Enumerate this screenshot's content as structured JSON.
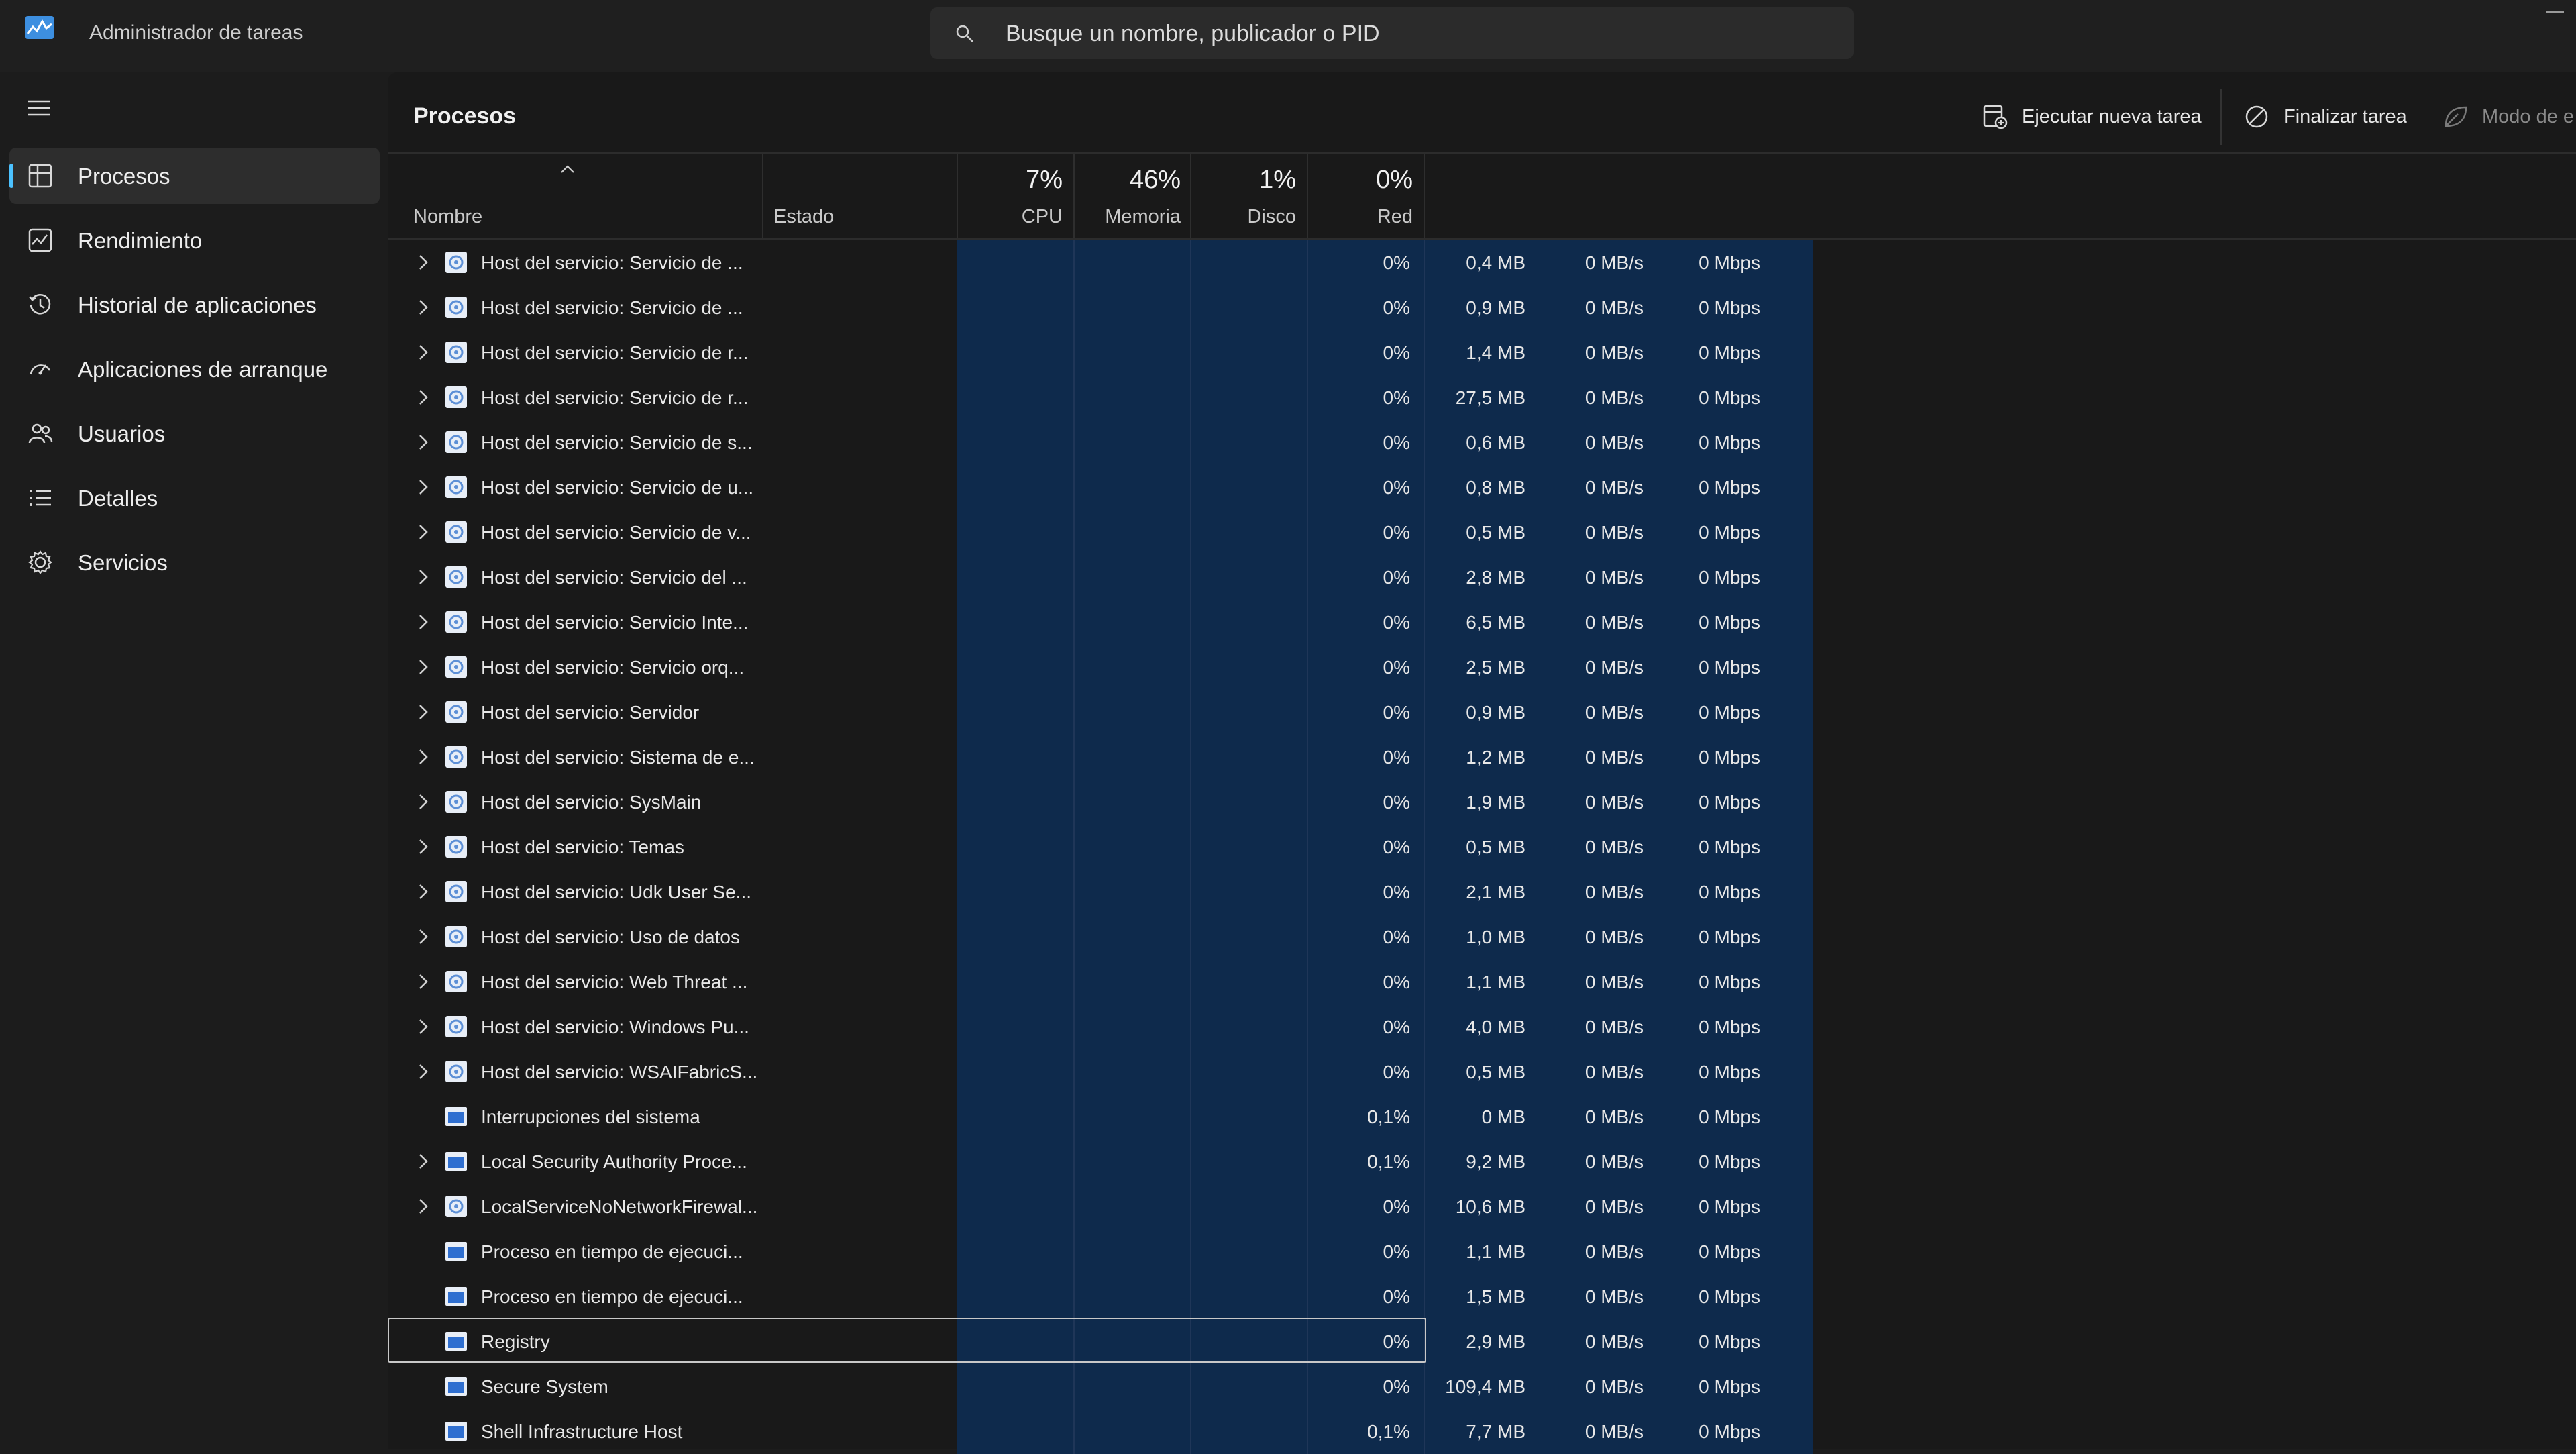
{
  "window": {
    "title": "Administrador de tareas"
  },
  "search": {
    "placeholder": "Busque un nombre, publicador o PID"
  },
  "sidebar": {
    "items": [
      {
        "label": "Procesos",
        "icon": "processes-icon",
        "active": true
      },
      {
        "label": "Rendimiento",
        "icon": "performance-icon"
      },
      {
        "label": "Historial de aplicaciones",
        "icon": "history-icon"
      },
      {
        "label": "Aplicaciones de arranque",
        "icon": "startup-icon"
      },
      {
        "label": "Usuarios",
        "icon": "users-icon"
      },
      {
        "label": "Detalles",
        "icon": "details-icon"
      },
      {
        "label": "Servicios",
        "icon": "services-icon"
      }
    ]
  },
  "toolbar": {
    "page_title": "Procesos",
    "run_task": "Ejecutar nueva tarea",
    "end_task": "Finalizar tarea",
    "efficiency": "Modo de e"
  },
  "table": {
    "headers": {
      "name": "Nombre",
      "status": "Estado",
      "cpu": {
        "pct": "7%",
        "label": "CPU"
      },
      "memory": {
        "pct": "46%",
        "label": "Memoria"
      },
      "disk": {
        "pct": "1%",
        "label": "Disco"
      },
      "network": {
        "pct": "0%",
        "label": "Red"
      }
    },
    "rows": [
      {
        "name": "Host del servicio: Servicio de ...",
        "cpu": "0%",
        "mem": "0,4 MB",
        "disk": "0 MB/s",
        "net": "0 Mbps",
        "expandable": true,
        "icon": "gear"
      },
      {
        "name": "Host del servicio: Servicio de ...",
        "cpu": "0%",
        "mem": "0,9 MB",
        "disk": "0 MB/s",
        "net": "0 Mbps",
        "expandable": true,
        "icon": "gear"
      },
      {
        "name": "Host del servicio: Servicio de r...",
        "cpu": "0%",
        "mem": "1,4 MB",
        "disk": "0 MB/s",
        "net": "0 Mbps",
        "expandable": true,
        "icon": "gear"
      },
      {
        "name": "Host del servicio: Servicio de r...",
        "cpu": "0%",
        "mem": "27,5 MB",
        "disk": "0 MB/s",
        "net": "0 Mbps",
        "expandable": true,
        "icon": "gear"
      },
      {
        "name": "Host del servicio: Servicio de s...",
        "cpu": "0%",
        "mem": "0,6 MB",
        "disk": "0 MB/s",
        "net": "0 Mbps",
        "expandable": true,
        "icon": "gear"
      },
      {
        "name": "Host del servicio: Servicio de u...",
        "cpu": "0%",
        "mem": "0,8 MB",
        "disk": "0 MB/s",
        "net": "0 Mbps",
        "expandable": true,
        "icon": "gear"
      },
      {
        "name": "Host del servicio: Servicio de v...",
        "cpu": "0%",
        "mem": "0,5 MB",
        "disk": "0 MB/s",
        "net": "0 Mbps",
        "expandable": true,
        "icon": "gear"
      },
      {
        "name": "Host del servicio: Servicio del ...",
        "cpu": "0%",
        "mem": "2,8 MB",
        "disk": "0 MB/s",
        "net": "0 Mbps",
        "expandable": true,
        "icon": "gear"
      },
      {
        "name": "Host del servicio: Servicio Inte...",
        "cpu": "0%",
        "mem": "6,5 MB",
        "disk": "0 MB/s",
        "net": "0 Mbps",
        "expandable": true,
        "icon": "gear"
      },
      {
        "name": "Host del servicio: Servicio orq...",
        "cpu": "0%",
        "mem": "2,5 MB",
        "disk": "0 MB/s",
        "net": "0 Mbps",
        "expandable": true,
        "icon": "gear"
      },
      {
        "name": "Host del servicio: Servidor",
        "cpu": "0%",
        "mem": "0,9 MB",
        "disk": "0 MB/s",
        "net": "0 Mbps",
        "expandable": true,
        "icon": "gear"
      },
      {
        "name": "Host del servicio: Sistema de e...",
        "cpu": "0%",
        "mem": "1,2 MB",
        "disk": "0 MB/s",
        "net": "0 Mbps",
        "expandable": true,
        "icon": "gear"
      },
      {
        "name": "Host del servicio: SysMain",
        "cpu": "0%",
        "mem": "1,9 MB",
        "disk": "0 MB/s",
        "net": "0 Mbps",
        "expandable": true,
        "icon": "gear"
      },
      {
        "name": "Host del servicio: Temas",
        "cpu": "0%",
        "mem": "0,5 MB",
        "disk": "0 MB/s",
        "net": "0 Mbps",
        "expandable": true,
        "icon": "gear"
      },
      {
        "name": "Host del servicio: Udk User Se...",
        "cpu": "0%",
        "mem": "2,1 MB",
        "disk": "0 MB/s",
        "net": "0 Mbps",
        "expandable": true,
        "icon": "gear"
      },
      {
        "name": "Host del servicio: Uso de datos",
        "cpu": "0%",
        "mem": "1,0 MB",
        "disk": "0 MB/s",
        "net": "0 Mbps",
        "expandable": true,
        "icon": "gear"
      },
      {
        "name": "Host del servicio: Web Threat ...",
        "cpu": "0%",
        "mem": "1,1 MB",
        "disk": "0 MB/s",
        "net": "0 Mbps",
        "expandable": true,
        "icon": "gear"
      },
      {
        "name": "Host del servicio: Windows Pu...",
        "cpu": "0%",
        "mem": "4,0 MB",
        "disk": "0 MB/s",
        "net": "0 Mbps",
        "expandable": true,
        "icon": "gear"
      },
      {
        "name": "Host del servicio: WSAIFabricS...",
        "cpu": "0%",
        "mem": "0,5 MB",
        "disk": "0 MB/s",
        "net": "0 Mbps",
        "expandable": true,
        "icon": "gear"
      },
      {
        "name": "Interrupciones del sistema",
        "cpu": "0,1%",
        "mem": "0 MB",
        "disk": "0 MB/s",
        "net": "0 Mbps",
        "expandable": false,
        "icon": "window"
      },
      {
        "name": "Local Security Authority Proce...",
        "cpu": "0,1%",
        "mem": "9,2 MB",
        "disk": "0 MB/s",
        "net": "0 Mbps",
        "expandable": true,
        "icon": "window"
      },
      {
        "name": "LocalServiceNoNetworkFirewal...",
        "cpu": "0%",
        "mem": "10,6 MB",
        "disk": "0 MB/s",
        "net": "0 Mbps",
        "expandable": true,
        "icon": "gear"
      },
      {
        "name": "Proceso en tiempo de ejecuci...",
        "cpu": "0%",
        "mem": "1,1 MB",
        "disk": "0 MB/s",
        "net": "0 Mbps",
        "expandable": false,
        "icon": "window"
      },
      {
        "name": "Proceso en tiempo de ejecuci...",
        "cpu": "0%",
        "mem": "1,5 MB",
        "disk": "0 MB/s",
        "net": "0 Mbps",
        "expandable": false,
        "icon": "window"
      },
      {
        "name": "Registry",
        "cpu": "0%",
        "mem": "2,9 MB",
        "disk": "0 MB/s",
        "net": "0 Mbps",
        "expandable": false,
        "icon": "window",
        "selected": true
      },
      {
        "name": "Secure System",
        "cpu": "0%",
        "mem": "109,4 MB",
        "disk": "0 MB/s",
        "net": "0 Mbps",
        "expandable": false,
        "icon": "window"
      },
      {
        "name": "Shell Infrastructure Host",
        "cpu": "0,1%",
        "mem": "7,7 MB",
        "disk": "0 MB/s",
        "net": "0 Mbps",
        "expandable": false,
        "icon": "window"
      }
    ]
  },
  "colors": {
    "accent": "#4cc2ff",
    "heat_cell": "#0e2a4c",
    "background": "#191919"
  }
}
